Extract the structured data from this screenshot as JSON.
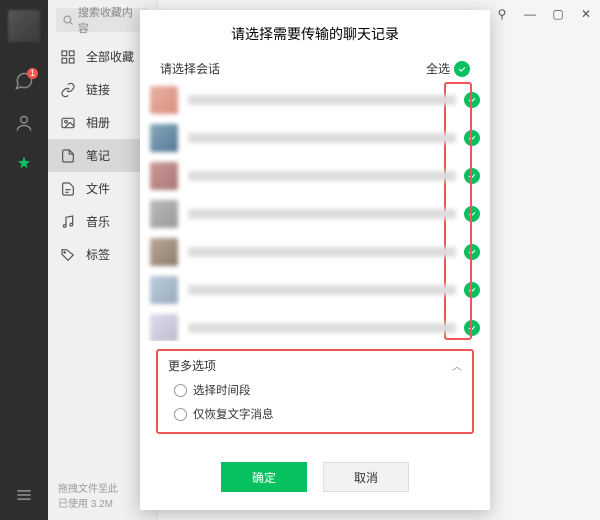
{
  "rail": {
    "chat_badge": "1"
  },
  "sidebar": {
    "search_placeholder": "搜索收藏内容",
    "items": [
      {
        "label": "全部收藏"
      },
      {
        "label": "链接"
      },
      {
        "label": "相册"
      },
      {
        "label": "笔记"
      },
      {
        "label": "文件"
      },
      {
        "label": "音乐"
      },
      {
        "label": "标签"
      }
    ],
    "footer_line1": "拖拽文件至此",
    "footer_line2": "已使用 3.2M"
  },
  "window": {
    "pin": "⚲",
    "min": "—",
    "max": "▢",
    "close": "✕"
  },
  "modal": {
    "title": "请选择需要传输的聊天记录",
    "select_session_label": "请选择会话",
    "select_all_label": "全选",
    "more_options_label": "更多选项",
    "option_time_range": "选择时间段",
    "option_text_only": "仅恢复文字消息",
    "confirm": "确定",
    "cancel": "取消"
  }
}
